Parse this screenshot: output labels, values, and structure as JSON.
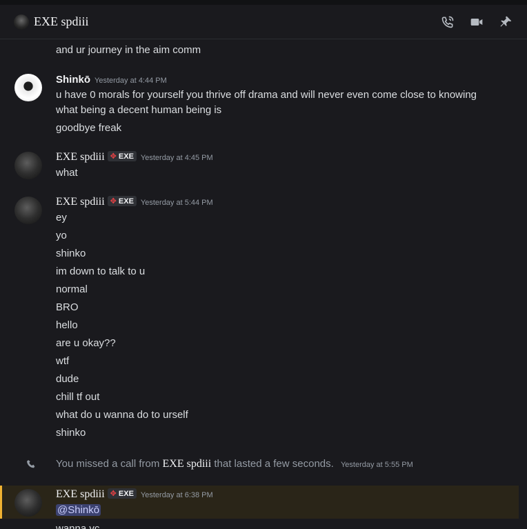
{
  "header": {
    "title": "EXE spdiii",
    "icons": [
      "phone-call-icon",
      "video-call-icon",
      "pin-icon"
    ]
  },
  "messages": {
    "prev_tail": "and ur journey in the aim comm",
    "group1": {
      "author": "Shinkō",
      "timestamp": "Yesterday at 4:44 PM",
      "lines": [
        "u have 0 morals for yourself you thrive off drama and will never even come close to knowing",
        "what being a decent human being is",
        "goodbye freak"
      ]
    },
    "group2": {
      "author": "EXE spdiii",
      "tag": "EXE",
      "timestamp": "Yesterday at 4:45 PM",
      "lines": [
        "what"
      ]
    },
    "group3": {
      "author": "EXE spdiii",
      "tag": "EXE",
      "timestamp": "Yesterday at 5:44 PM",
      "lines": [
        "ey",
        "yo",
        "shinko",
        "im down to talk to u",
        "normal",
        "BRO",
        "hello",
        "are u okay??",
        "wtf",
        "dude",
        "chill tf out",
        "what do u wanna do to urself",
        "shinko"
      ]
    },
    "missed_call": {
      "prefix": "You missed a call from",
      "name": "EXE spdiii",
      "suffix": "that lasted a few seconds.",
      "timestamp": "Yesterday at 5:55 PM"
    },
    "group4": {
      "author": "EXE spdiii",
      "tag": "EXE",
      "timestamp": "Yesterday at 6:38 PM",
      "mention": "@Shinkō",
      "next_line": "wanna vc"
    }
  },
  "colors": {
    "background": "#1a1a1e",
    "highlight_border": "#f0b232",
    "mention_bg": "#3c4270"
  }
}
